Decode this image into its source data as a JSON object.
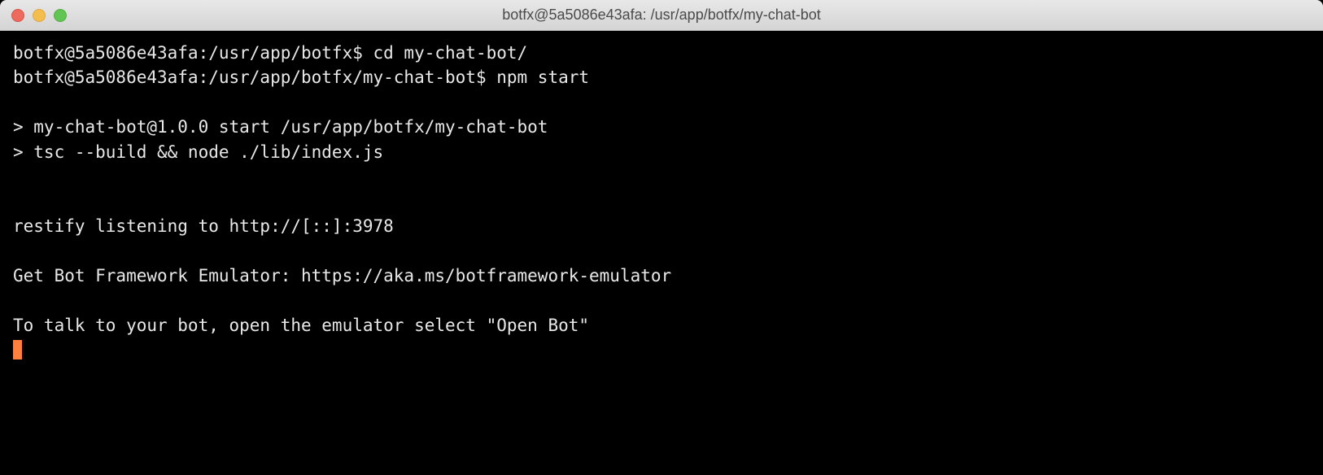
{
  "titlebar": {
    "title": "botfx@5a5086e43afa: /usr/app/botfx/my-chat-bot"
  },
  "terminal": {
    "lines": [
      "botfx@5a5086e43afa:/usr/app/botfx$ cd my-chat-bot/",
      "botfx@5a5086e43afa:/usr/app/botfx/my-chat-bot$ npm start",
      "",
      "> my-chat-bot@1.0.0 start /usr/app/botfx/my-chat-bot",
      "> tsc --build && node ./lib/index.js",
      "",
      "",
      "restify listening to http://[::]:3978",
      "",
      "Get Bot Framework Emulator: https://aka.ms/botframework-emulator",
      "",
      "To talk to your bot, open the emulator select \"Open Bot\""
    ]
  }
}
